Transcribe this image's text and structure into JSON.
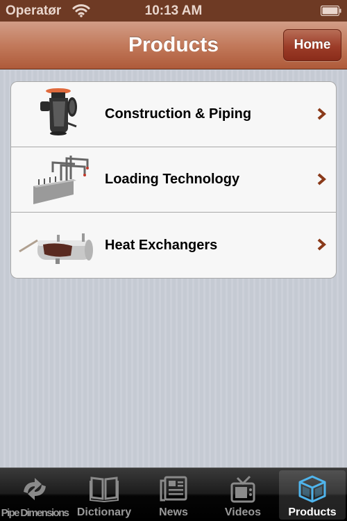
{
  "status_bar": {
    "carrier": "Operatør",
    "time": "10:13 AM",
    "wifi_icon": "wifi-icon",
    "battery_icon": "battery-icon"
  },
  "nav_bar": {
    "title": "Products",
    "home_label": "Home"
  },
  "products": [
    {
      "label": "Construction & Piping",
      "icon": "strainer-valve-image"
    },
    {
      "label": "Loading Technology",
      "icon": "loading-arm-image"
    },
    {
      "label": "Heat Exchangers",
      "icon": "heat-exchanger-image"
    }
  ],
  "tab_bar": {
    "tabs": [
      {
        "label": "Pipe Dimensions",
        "icon": "swap-arrows-icon",
        "active": false
      },
      {
        "label": "Dictionary",
        "icon": "book-icon",
        "active": false
      },
      {
        "label": "News",
        "icon": "newspaper-icon",
        "active": false
      },
      {
        "label": "Videos",
        "icon": "tv-icon",
        "active": false
      },
      {
        "label": "Products",
        "icon": "cube-icon",
        "active": true
      }
    ]
  },
  "colors": {
    "nav_brown": "#c27a5c",
    "status_brown": "#6e3a24",
    "chevron": "#8a3a1a",
    "active_tab_icon": "#4fb4ec"
  }
}
